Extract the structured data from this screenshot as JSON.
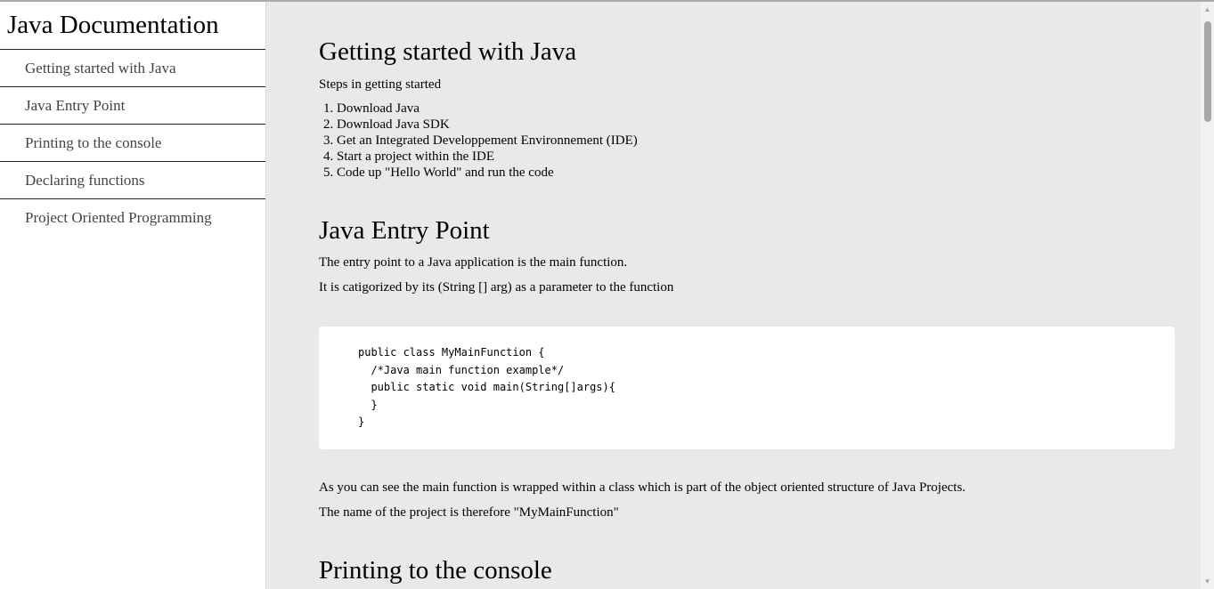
{
  "navbar": {
    "title": "Java Documentation",
    "links": [
      "Getting started with Java",
      "Java Entry Point",
      "Printing to the console",
      "Declaring functions",
      "Project Oriented Programming"
    ]
  },
  "sections": {
    "getting_started": {
      "title": "Getting started with Java",
      "intro": "Steps in getting started",
      "steps": [
        "Download Java",
        "Download Java SDK",
        "Get an Integrated Developpement Environnement (IDE)",
        "Start a project within the IDE",
        "Code up \"Hello World\" and run the code"
      ]
    },
    "entry_point": {
      "title": "Java Entry Point",
      "p1": "The entry point to a Java application is the main function.",
      "p2": "It is catigorized by its (String [] arg) as a parameter to the function",
      "code": "public class MyMainFunction {\n  /*Java main function example*/\n  public static void main(String[]args){\n  }\n}",
      "p3": "As you can see the main function is wrapped within a class which is part of the object oriented structure of Java Projects.",
      "p4": "The name of the project is therefore \"MyMainFunction\""
    },
    "printing": {
      "title": "Printing to the console"
    }
  },
  "scrollbar": {
    "up_icon": "▲",
    "down_icon": "▼",
    "position_fraction": 0.0
  }
}
